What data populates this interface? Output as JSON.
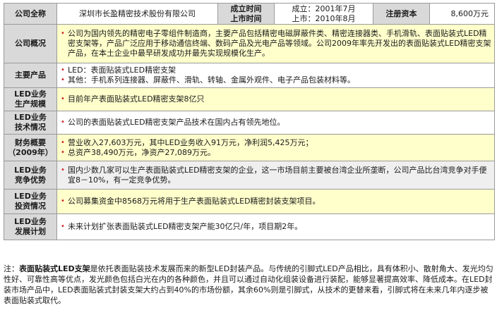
{
  "header": {
    "full_name_label": "公司全称",
    "full_name_value": "深圳市长盈精密技术股份有限公司",
    "founded_label": "成立时间",
    "listed_label": "上市时间",
    "founded_value": "成立：2001年7月",
    "listed_value": "上市：2010年8月",
    "capital_label": "注册资本",
    "capital_value": "8,600万元"
  },
  "rows": [
    {
      "label_lines": [
        "公司概况"
      ],
      "items": [
        "公司为国内领先的精密电子零组件制造商，主要产品包括精密电磁屏蔽件类、精密连接器类、手机滑轨、表面贴装式LED精密支架等，产品广泛应用于移动通信终端、数码产品及光电产品等领域。公司2009年率先开发出的表面贴装式LED精密支架产品，在本土企业中最早研发成功并最先实现规模化生产。"
      ]
    },
    {
      "label_lines": [
        "主要产品"
      ],
      "items": [
        "LED：表面贴装式LED精密支架",
        "其他：手机系列连接器、屏蔽件、滑轨、转轴、金属外观件、电子产品包装材料等。"
      ]
    },
    {
      "label_lines": [
        "LED业务",
        "生产规模"
      ],
      "items": [
        "目前年产表面贴装式LED精密支架8亿只"
      ]
    },
    {
      "label_lines": [
        "LED业务",
        "技术情况"
      ],
      "items": [
        "公司的表面贴装式LED精密支架产品技术在国内占有领先地位。"
      ]
    },
    {
      "label_lines": [
        "财务概要",
        "（2009年）"
      ],
      "items": [
        "营业收入27,603万元，其中LED业务收入91万元，净利润5,425万元；",
        "总资产38,490万元，净资产27,089万元。"
      ]
    },
    {
      "label_lines": [
        "LED业务",
        "竞争优势"
      ],
      "items": [
        "国内少数几家可以生产表面贴装式LED精密支架的企业，这一市场目前主要被台湾企业所垄断，公司产品比台湾竞争对手便宜8－10%，有一定竞争优势。"
      ]
    },
    {
      "label_lines": [
        "LED业务",
        "投资情况"
      ],
      "items": [
        "公司募集资金中8568万元将用于生产表面贴装式LED精密封装支架项目。"
      ]
    },
    {
      "label_lines": [
        "LED业务",
        "发展计划"
      ],
      "items": [
        "未来计划扩张表面贴装式LED精密支架产能30亿只/年，项目期2年。"
      ]
    }
  ],
  "note": {
    "prefix": "注：",
    "term": "表面贴装式LED支架",
    "text": "是依托表面贴装技术发展而来的新型LED封装产品。与传统的引脚式LED产品相比，具有体积小、散射角大、发光均匀性好、可靠性高等优点，发光颜色包括白光在内的各种颜色，并且可以通过自动化组装设备进行装配，能够显著提高效率、降低成本。在LED封装市场产品中，LED表面贴装式封装支架大约占到40%的市场份额，其余60%则是引脚式，从技术的更替来看，引脚式将在未来几年内逐步被表面贴装式取代。"
  },
  "colors": {
    "label_bg": "#d9d9d9",
    "row_highlight": "#ffffcc",
    "row_alt": "#efefef",
    "bullet": "#d22020",
    "border": "#9a9a9a"
  }
}
